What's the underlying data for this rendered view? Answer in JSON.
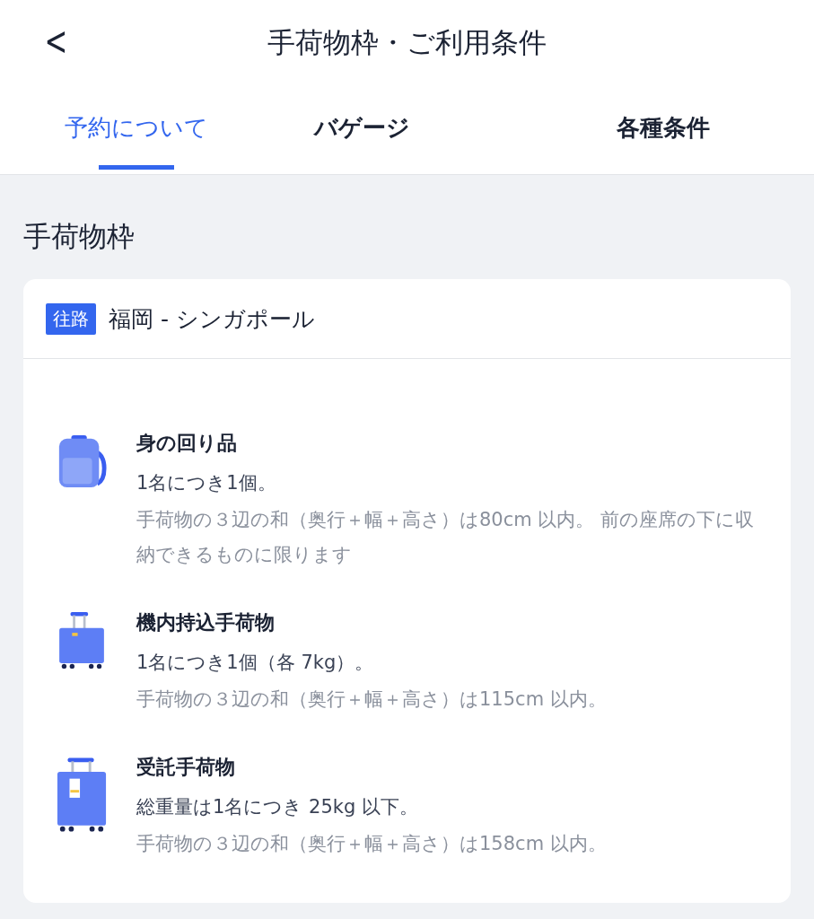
{
  "header": {
    "back": "<",
    "title": "手荷物枠・ご利用条件"
  },
  "tabs": [
    {
      "label": "予約について",
      "selected": true
    },
    {
      "label": "バゲージ",
      "selected": false
    },
    {
      "label": "各種条件",
      "selected": false
    }
  ],
  "section_title": "手荷物枠",
  "route": {
    "tag": "往路",
    "name": "福岡 - シンガポール"
  },
  "items": [
    {
      "kind": "backpack",
      "title": "身の回り品",
      "allowance": "1名につき1個。",
      "note": "手荷物の３辺の和（奥行＋幅＋高さ）は80cm 以内。 前の座席の下に収納できるものに限ります"
    },
    {
      "kind": "carry_on",
      "title": "機内持込手荷物",
      "allowance": "1名につき1個（各 7kg）。",
      "note": "手荷物の３辺の和（奥行＋幅＋高さ）は115cm 以内。"
    },
    {
      "kind": "checked",
      "title": "受託手荷物",
      "allowance": "総重量は1名につき 25kg 以下。",
      "note": "手荷物の３辺の和（奥行＋幅＋高さ）は158cm 以内。"
    }
  ]
}
